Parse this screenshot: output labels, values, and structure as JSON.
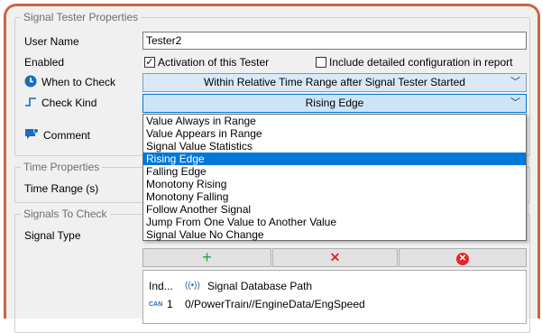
{
  "signal_tester": {
    "legend": "Signal Tester Properties",
    "user_name_label": "User Name",
    "user_name_value": "Tester2",
    "enabled_label": "Enabled",
    "activation_label": "Activation of this Tester",
    "activation_checked": true,
    "include_config_label": "Include detailed configuration in report",
    "include_config_checked": false,
    "when_to_check_label": "When to Check",
    "when_to_check_value": "Within Relative Time Range after Signal Tester Started",
    "check_kind_label": "Check Kind",
    "check_kind_value": "Rising Edge",
    "comment_label": "Comment"
  },
  "check_kind_options": [
    "Value Always in Range",
    "Value Appears in Range",
    "Signal Value Statistics",
    "Rising Edge",
    "Falling Edge",
    "Monotony Rising",
    "Monotony Falling",
    "Follow Another Signal",
    "Jump From One Value to Another Value",
    "Signal Value No Change"
  ],
  "selected_option_index": 3,
  "time_properties": {
    "legend": "Time Properties",
    "time_range_label": "Time Range (s)"
  },
  "signals_to_check": {
    "legend": "Signals To Check",
    "signal_type_label": "Signal Type",
    "add_glyph": "+",
    "remove_glyph": "✕",
    "clear_glyph": "✕",
    "table": {
      "col_index": "Ind...",
      "col_path": "Signal Database Path",
      "rows": [
        {
          "badge": "CAN",
          "index": "1",
          "path": "0/PowerTrain//EngineData/EngSpeed"
        }
      ]
    }
  },
  "colors": {
    "accent": "#c9663f",
    "selection": "#0078d7",
    "add_green": "#22a33a",
    "remove_red": "#e0282c"
  }
}
